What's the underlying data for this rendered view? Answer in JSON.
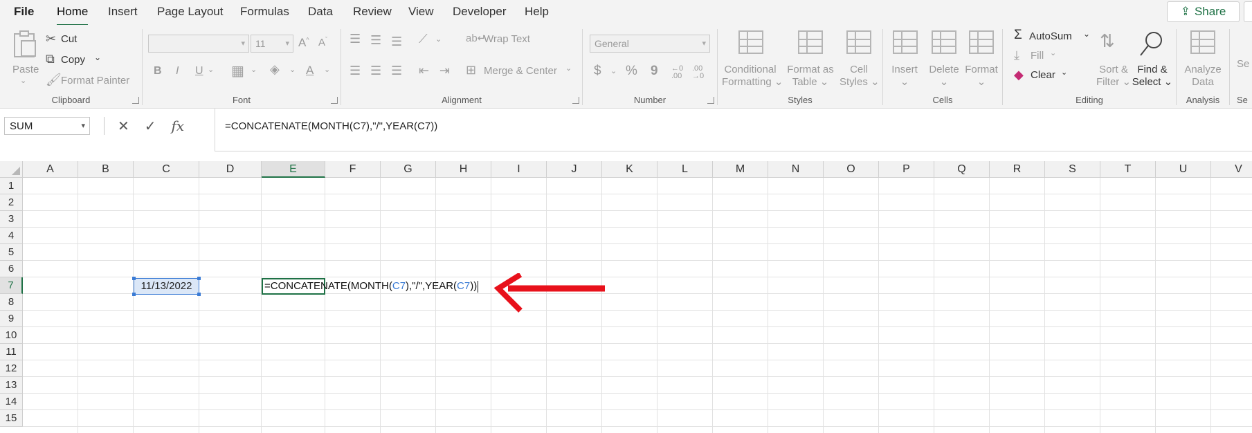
{
  "tabs": [
    "File",
    "Home",
    "Insert",
    "Page Layout",
    "Formulas",
    "Data",
    "Review",
    "View",
    "Developer",
    "Help"
  ],
  "active_tab": "Home",
  "share_label": "Share",
  "ribbon": {
    "clipboard": {
      "label": "Clipboard",
      "paste": "Paste",
      "cut": "Cut",
      "copy": "Copy",
      "format_painter": "Format Painter"
    },
    "font": {
      "label": "Font",
      "size": "11",
      "bold": "B",
      "italic": "I",
      "underline": "U"
    },
    "alignment": {
      "label": "Alignment",
      "wrap_text": "Wrap Text",
      "merge_center": "Merge & Center"
    },
    "number": {
      "label": "Number",
      "format": "General",
      "currency": "$",
      "percent": "%",
      "comma": "9"
    },
    "styles": {
      "label": "Styles",
      "conditional": [
        "Conditional",
        "Formatting"
      ],
      "format_table": [
        "Format as",
        "Table"
      ],
      "cell_styles": [
        "Cell",
        "Styles"
      ]
    },
    "cells": {
      "label": "Cells",
      "insert": "Insert",
      "delete": "Delete",
      "format": "Format"
    },
    "editing": {
      "label": "Editing",
      "autosum": "AutoSum",
      "fill": "Fill",
      "clear": "Clear",
      "sort_filter": [
        "Sort &",
        "Filter"
      ],
      "find_select": [
        "Find &",
        "Select"
      ]
    },
    "analysis": {
      "label": "Analysis",
      "analyze": [
        "Analyze",
        "Data"
      ]
    },
    "sensitivity_partial": {
      "label": "Se",
      "text": "Se"
    }
  },
  "formula_bar": {
    "name_box": "SUM",
    "formula": "=CONCATENATE(MONTH(C7),\"/\",YEAR(C7))"
  },
  "columns": [
    "A",
    "B",
    "C",
    "D",
    "E",
    "F",
    "G",
    "H",
    "I",
    "J",
    "K",
    "L",
    "M",
    "N",
    "O",
    "P",
    "Q",
    "R",
    "S",
    "T",
    "U",
    "V"
  ],
  "selected_column": "E",
  "rows": [
    "1",
    "2",
    "3",
    "4",
    "5",
    "6",
    "7",
    "8",
    "9",
    "10",
    "11",
    "12",
    "13",
    "14",
    "15"
  ],
  "selected_row": "7",
  "cells": {
    "C7": "11/13/2022",
    "E7_parts": [
      "=CONCATENATE(MONTH(",
      "C7",
      "),\"/\",YEAR(",
      "C7",
      "))"
    ]
  },
  "colors": {
    "accent": "#1e7145",
    "reference": "#3a7bd5",
    "arrow": "#e8111b"
  }
}
